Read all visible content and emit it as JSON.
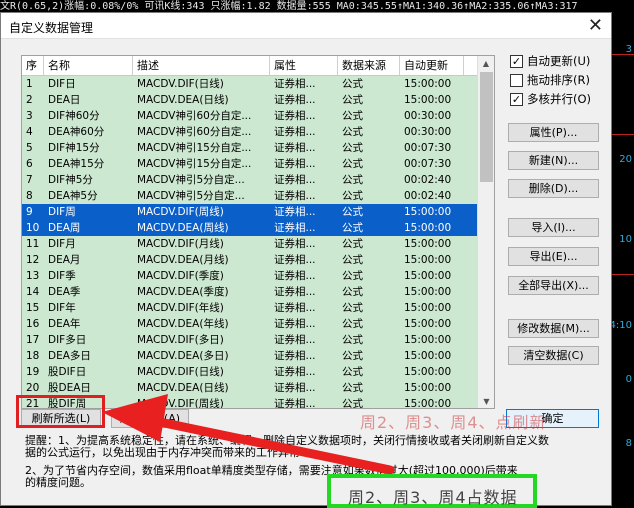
{
  "background": {
    "top_strip": "文R(0.65,2)涨幅:0.08%/0% 可讯K线:343  只涨幅:1.82 数据量:555  MA0:345.55↑MA1:340.36↑MA2:335.06↑MA3:317",
    "right_labels": [
      "3",
      "20",
      "10",
      "4:10",
      "0",
      "8"
    ]
  },
  "dialog": {
    "title": "自定义数据管理",
    "close_glyph": "✕"
  },
  "table": {
    "columns": [
      "序",
      "名称",
      "描述",
      "属性",
      "数据来源",
      "自动更新"
    ],
    "rows": [
      {
        "id": "1",
        "name": "DIF日",
        "desc": "MACDV.DIF(日线)",
        "attr": "证券相...",
        "src": "公式",
        "auto": "15:00:00",
        "selected": false
      },
      {
        "id": "2",
        "name": "DEA日",
        "desc": "MACDV.DEA(日线)",
        "attr": "证券相...",
        "src": "公式",
        "auto": "15:00:00",
        "selected": false
      },
      {
        "id": "3",
        "name": "DIF神60分",
        "desc": "MACDV神引60分自定...",
        "attr": "证券相...",
        "src": "公式",
        "auto": "00:30:00",
        "selected": false
      },
      {
        "id": "4",
        "name": "DEA神60分",
        "desc": "MACDV神引60分自定...",
        "attr": "证券相...",
        "src": "公式",
        "auto": "00:30:00",
        "selected": false
      },
      {
        "id": "5",
        "name": "DIF神15分",
        "desc": "MACDV神引15分自定...",
        "attr": "证券相...",
        "src": "公式",
        "auto": "00:07:30",
        "selected": false
      },
      {
        "id": "6",
        "name": "DEA神15分",
        "desc": "MACDV神引15分自定...",
        "attr": "证券相...",
        "src": "公式",
        "auto": "00:07:30",
        "selected": false
      },
      {
        "id": "7",
        "name": "DIF神5分",
        "desc": "MACDV神引5分自定...",
        "attr": "证券相...",
        "src": "公式",
        "auto": "00:02:40",
        "selected": false
      },
      {
        "id": "8",
        "name": "DEA神5分",
        "desc": "MACDV神引5分自定...",
        "attr": "证券相...",
        "src": "公式",
        "auto": "00:02:40",
        "selected": false
      },
      {
        "id": "9",
        "name": "DIF周",
        "desc": "MACDV.DIF(周线)",
        "attr": "证券相...",
        "src": "公式",
        "auto": "15:00:00",
        "selected": true
      },
      {
        "id": "10",
        "name": "DEA周",
        "desc": "MACDV.DEA(周线)",
        "attr": "证券相...",
        "src": "公式",
        "auto": "15:00:00",
        "selected": true
      },
      {
        "id": "11",
        "name": "DIF月",
        "desc": "MACDV.DIF(月线)",
        "attr": "证券相...",
        "src": "公式",
        "auto": "15:00:00",
        "selected": false
      },
      {
        "id": "12",
        "name": "DEA月",
        "desc": "MACDV.DEA(月线)",
        "attr": "证券相...",
        "src": "公式",
        "auto": "15:00:00",
        "selected": false
      },
      {
        "id": "13",
        "name": "DIF季",
        "desc": "MACDV.DIF(季度)",
        "attr": "证券相...",
        "src": "公式",
        "auto": "15:00:00",
        "selected": false
      },
      {
        "id": "14",
        "name": "DEA季",
        "desc": "MACDV.DEA(季度)",
        "attr": "证券相...",
        "src": "公式",
        "auto": "15:00:00",
        "selected": false
      },
      {
        "id": "15",
        "name": "DIF年",
        "desc": "MACDV.DIF(年线)",
        "attr": "证券相...",
        "src": "公式",
        "auto": "15:00:00",
        "selected": false
      },
      {
        "id": "16",
        "name": "DEA年",
        "desc": "MACDV.DEA(年线)",
        "attr": "证券相...",
        "src": "公式",
        "auto": "15:00:00",
        "selected": false
      },
      {
        "id": "17",
        "name": "DIF多日",
        "desc": "MACDV.DIF(多日)",
        "attr": "证券相...",
        "src": "公式",
        "auto": "15:00:00",
        "selected": false
      },
      {
        "id": "18",
        "name": "DEA多日",
        "desc": "MACDV.DEA(多日)",
        "attr": "证券相...",
        "src": "公式",
        "auto": "15:00:00",
        "selected": false
      },
      {
        "id": "19",
        "name": "股DIF日",
        "desc": "MACDV.DIF(日线)",
        "attr": "证券相...",
        "src": "公式",
        "auto": "15:00:00",
        "selected": false
      },
      {
        "id": "20",
        "name": "股DEA日",
        "desc": "MACDV.DEA(日线)",
        "attr": "证券相...",
        "src": "公式",
        "auto": "15:00:00",
        "selected": false
      },
      {
        "id": "21",
        "name": "股DIF周",
        "desc": "MACDV.DIF(周线)",
        "attr": "证券相...",
        "src": "公式",
        "auto": "15:00:00",
        "selected": false
      }
    ]
  },
  "options": {
    "auto_update": {
      "label": "自动更新(U)",
      "checked": true
    },
    "drag_sort": {
      "label": "拖动排序(R)",
      "checked": false
    },
    "multicore": {
      "label": "多核并行(O)",
      "checked": true
    }
  },
  "buttons": {
    "properties": "属性(P)...",
    "new": "新建(N)...",
    "delete": "删除(D)...",
    "import": "导入(I)...",
    "export": "导出(E)...",
    "export_all": "全部导出(X)...",
    "modify": "修改数据(M)...",
    "clear": "清空数据(C)",
    "refresh_selected": "刷新所选(L)",
    "refresh_all": "刷新全部(A)",
    "ok": "确定"
  },
  "hints": {
    "line1": "提醒：1、为提高系统稳定性，请在系统、编辑、删除自定义数据项时，关闭行情接收或者关闭刷新自定义数",
    "line2": "据的公式运行，以免出现由于内存冲突而带来的工作异常",
    "line3": "      2、为了节省内存空间，数值采用float单精度类型存储，需要注意如果数值过大(超过100,000)后带来",
    "line4": "的精度问题。"
  },
  "annotations": {
    "red_text": "周2、周3、周4、点刷新",
    "green_text": "周2、周3、周4占数据"
  }
}
